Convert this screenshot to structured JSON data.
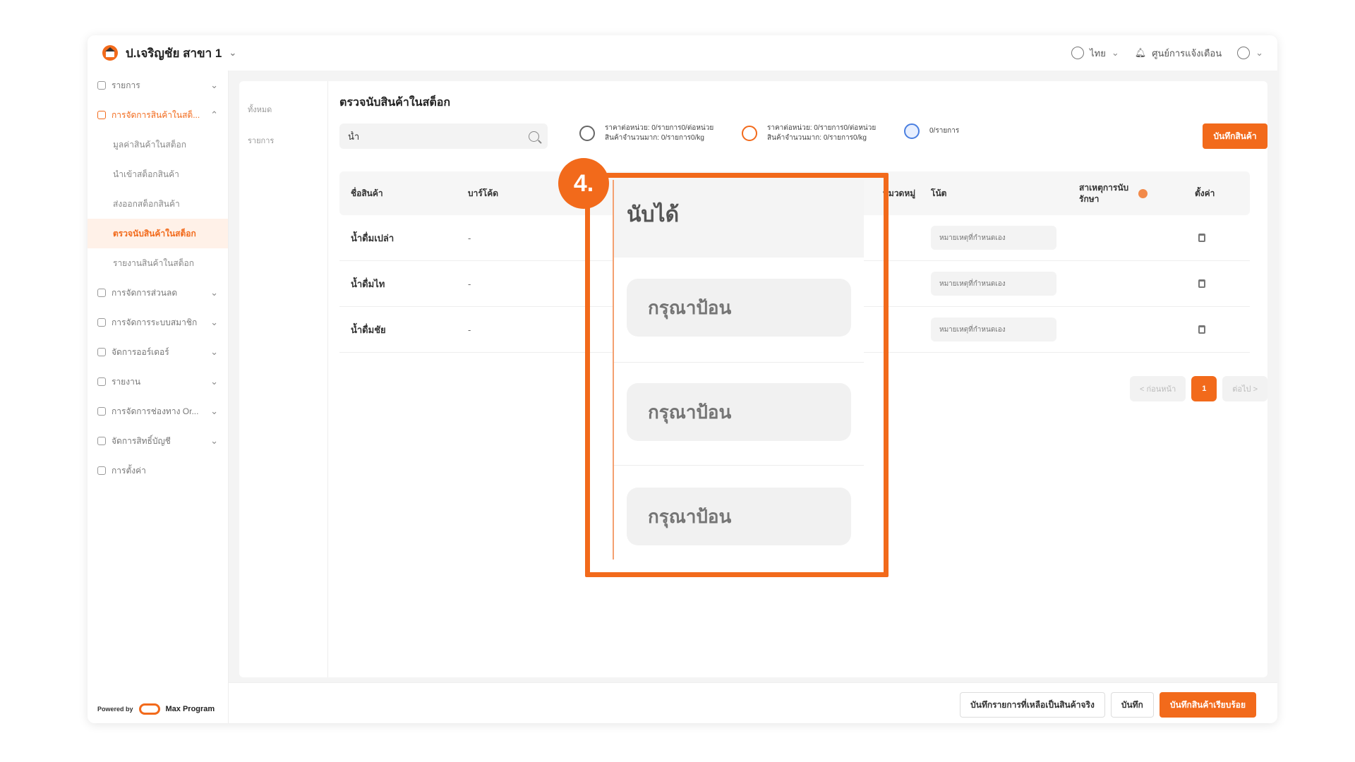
{
  "header": {
    "branch": "ป.เจริญชัย สาขา 1",
    "language": "ไทย",
    "notifications": "ศูนย์การแจ้งเตือน"
  },
  "sidebar": {
    "items": [
      {
        "label": "รายการ"
      },
      {
        "label": "การจัดการสินค้าในสต็..."
      }
    ],
    "sub_items": [
      {
        "label": "มูลค่าสินค้าในสต็อก"
      },
      {
        "label": "นำเข้าสต็อกสินค้า"
      },
      {
        "label": "ส่งออกสต็อกสินค้า"
      },
      {
        "label": "ตรวจนับสินค้าในสต็อก"
      },
      {
        "label": "รายงานสินค้าในสต็อก"
      }
    ],
    "more_items": [
      {
        "label": "การจัดการส่วนลด"
      },
      {
        "label": "การจัดการระบบสมาชิก"
      },
      {
        "label": "จัดการออร์เดอร์"
      },
      {
        "label": "รายงาน"
      },
      {
        "label": "การจัดการช่องทาง Or..."
      },
      {
        "label": "จัดการสิทธิ์บัญชี"
      },
      {
        "label": "การตั้งค่า"
      }
    ],
    "powered_by": "Powered by",
    "logo_text": "Max Program"
  },
  "subnav": [
    "ทั้งหมด",
    "รายการ"
  ],
  "page": {
    "title": "ตรวจนับสินค้าในสต็อก",
    "search_value": "น้ำ",
    "legend": [
      {
        "line1": "ราคาต่อหน่วย: 0/รายการ0/ต่อหน่วย",
        "line2": "สินค้าจำนวนมาก: 0/รายการ0/kg"
      },
      {
        "line1": "ราคาต่อหน่วย: 0/รายการ0/ต่อหน่วย",
        "line2": "สินค้าจำนวนมาก: 0/รายการ0/kg"
      },
      {
        "line1": "0/รายการ",
        "line2": ""
      }
    ],
    "add_button": "บันทึกสินค้า"
  },
  "table": {
    "headers": {
      "name": "ชื่อสินค้า",
      "barcode": "บาร์โค้ด",
      "category": "หมวดหมู่",
      "note": "โน้ต",
      "stock_line1": "สาเหตุการนับ",
      "stock_line2": "รักษา",
      "setting": "ตั้งค่า"
    },
    "rows": [
      {
        "name": "น้ำดื่มเปล่า",
        "barcode": "-",
        "note_placeholder": "หมายเหตุที่กำหนดเอง"
      },
      {
        "name": "น้ำดื่มไท",
        "barcode": "-",
        "note_placeholder": "หมายเหตุที่กำหนดเอง"
      },
      {
        "name": "น้ำดื่มชัย",
        "barcode": "-",
        "note_placeholder": "หมายเหตุที่กำหนดเอง"
      }
    ]
  },
  "pagination": {
    "prev": "< ก่อนหน้า",
    "current": "1",
    "next": "ต่อไป >"
  },
  "footer": {
    "btn_save_not_counted": "บันทึกรายการที่เหลือเป็นสินค้าจริง",
    "btn_save": "บันทึก",
    "btn_save_complete": "บันทึกสินค้าเรียบร้อย"
  },
  "callout": {
    "number": "4.",
    "column_header": "นับได้",
    "field_placeholder": "กรุณาป้อน"
  },
  "colors": {
    "accent": "#f26a1b"
  }
}
